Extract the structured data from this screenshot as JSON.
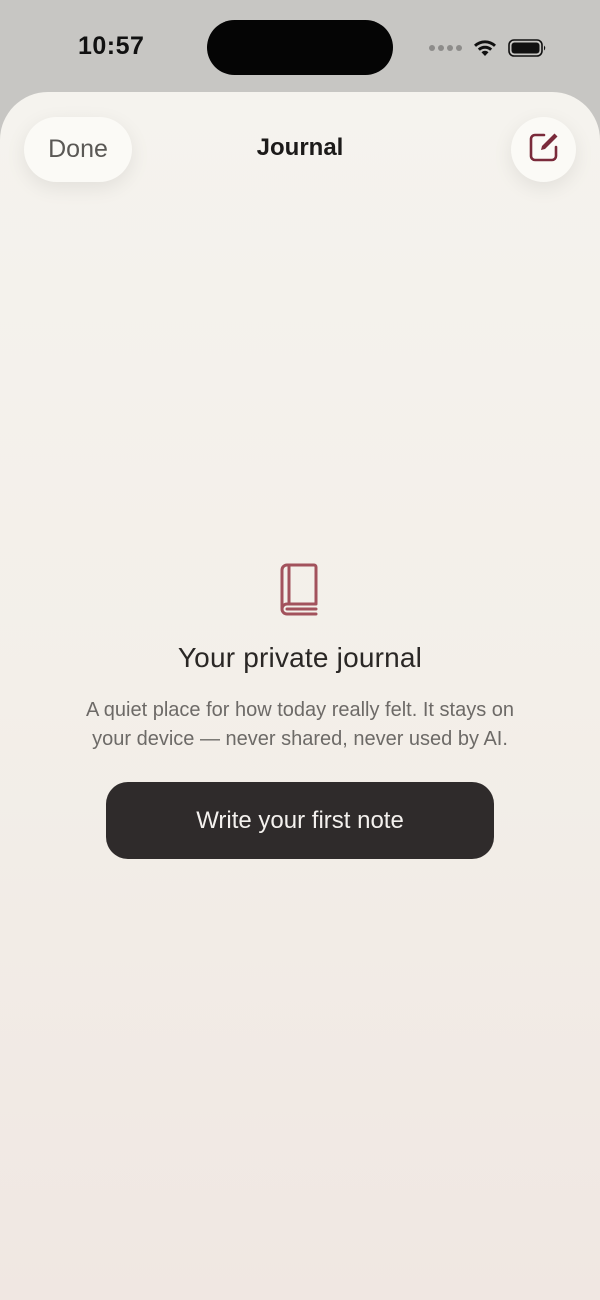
{
  "status_bar": {
    "time": "10:57",
    "icons": [
      "signal-dots-icon",
      "wifi-icon",
      "battery-icon"
    ]
  },
  "header": {
    "done_label": "Done",
    "title": "Journal",
    "compose_icon": "compose-icon"
  },
  "empty_state": {
    "icon": "book-icon",
    "title": "Your private journal",
    "description": "A quiet place for how today really felt. It stays on your device — never shared, never used by AI.",
    "button_label": "Write your first note"
  },
  "colors": {
    "accent": "#9b4452",
    "button_dark": "#2f2b2b",
    "sheet_background": "#f4f1ec"
  }
}
